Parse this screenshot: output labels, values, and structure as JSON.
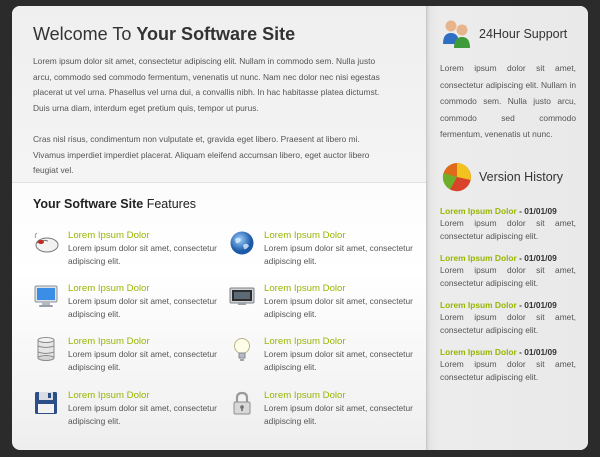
{
  "welcome": {
    "title_prefix": "Welcome To ",
    "title_strong": "Your Software Site",
    "para1": "Lorem ipsum dolor sit amet, consectetur adipiscing elit. Nullam in commodo sem. Nulla justo arcu, commodo sed commodo fermentum, venenatis ut nunc. Nam nec dolor nec nisi egestas placerat ut vel urna. Phasellus vel urna dui, a convallis nibh. In hac habitasse platea dictumst. Duis urna diam, interdum eget pretium quis, tempor ut purus.",
    "para2": "Cras nisl risus, condimentum non vulputate et, gravida eget libero. Praesent at libero mi. Vivamus imperdiet imperdiet placerat. Aliquam eleifend accumsan libero, eget auctor libero feugiat vel."
  },
  "features": {
    "title_strong": "Your Software Site",
    "title_rest": " Features",
    "items": [
      {
        "icon": "mouse-icon",
        "title": "Lorem Ipsum Dolor",
        "text": "Lorem ipsum dolor sit amet, consectetur adipiscing elit."
      },
      {
        "icon": "globe-icon",
        "title": "Lorem Ipsum Dolor",
        "text": "Lorem ipsum dolor sit amet, consectetur adipiscing elit."
      },
      {
        "icon": "monitor-icon",
        "title": "Lorem Ipsum Dolor",
        "text": "Lorem ipsum dolor sit amet, consectetur adipiscing elit."
      },
      {
        "icon": "display-icon",
        "title": "Lorem Ipsum Dolor",
        "text": "Lorem ipsum dolor sit amet, consectetur adipiscing elit."
      },
      {
        "icon": "database-icon",
        "title": "Lorem Ipsum Dolor",
        "text": "Lorem ipsum dolor sit amet, consectetur adipiscing elit."
      },
      {
        "icon": "lightbulb-icon",
        "title": "Lorem Ipsum Dolor",
        "text": "Lorem ipsum dolor sit amet, consectetur adipiscing elit."
      },
      {
        "icon": "floppy-disk-icon",
        "title": "Lorem Ipsum Dolor",
        "text": "Lorem ipsum dolor sit amet, consectetur adipiscing elit."
      },
      {
        "icon": "padlock-icon",
        "title": "Lorem Ipsum Dolor",
        "text": "Lorem ipsum dolor sit amet, consectetur adipiscing elit."
      }
    ]
  },
  "support": {
    "icon": "users-icon",
    "title": "24Hour Support",
    "text": "Lorem ipsum dolor sit amet, consectetur adipiscing elit. Nullam in commodo sem. Nulla justo arcu, commodo sed commodo fermentum, venenatis ut nunc."
  },
  "version_history": {
    "icon": "pie-chart-icon",
    "title": "Version History",
    "items": [
      {
        "name": "Lorem Ipsum Dolor",
        "date": " - 01/01/09",
        "text": "Lorem ipsum dolor sit amet, consectetur adipiscing elit."
      },
      {
        "name": "Lorem Ipsum Dolor",
        "date": " - 01/01/09",
        "text": "Lorem ipsum dolor sit amet, consectetur adipiscing elit."
      },
      {
        "name": "Lorem Ipsum Dolor",
        "date": " - 01/01/09",
        "text": "Lorem ipsum dolor sit amet, consectetur adipiscing elit."
      },
      {
        "name": "Lorem Ipsum Dolor",
        "date": " - 01/01/09",
        "text": "Lorem ipsum dolor sit amet, consectetur adipiscing elit."
      }
    ]
  },
  "colors": {
    "accent": "#99b500",
    "page_bg": "#2b2b2b",
    "text": "#555555"
  }
}
